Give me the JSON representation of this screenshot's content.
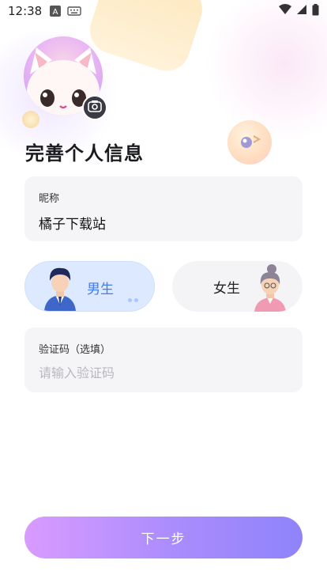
{
  "status_bar": {
    "time": "12:38",
    "icons": [
      "a-letter-icon",
      "keyboard-icon",
      "wifi-icon",
      "signal-icon",
      "battery-icon"
    ]
  },
  "profile": {
    "title": "完善个人信息",
    "avatar_icon": "cat-avatar",
    "camera_icon": "camera-icon"
  },
  "nickname": {
    "label": "昵称",
    "value": "橘子下载站"
  },
  "gender": {
    "male_label": "男生",
    "female_label": "女生",
    "selected": "male"
  },
  "code": {
    "label": "验证码（选填）",
    "placeholder": "请输入验证码",
    "value": ""
  },
  "actions": {
    "next_label": "下一步"
  },
  "colors": {
    "accent_start": "#d99bff",
    "accent_end": "#8f83fb",
    "male_bg": "#dce9ff",
    "male_text": "#3f7bf4",
    "card_bg": "#f5f5f8"
  }
}
